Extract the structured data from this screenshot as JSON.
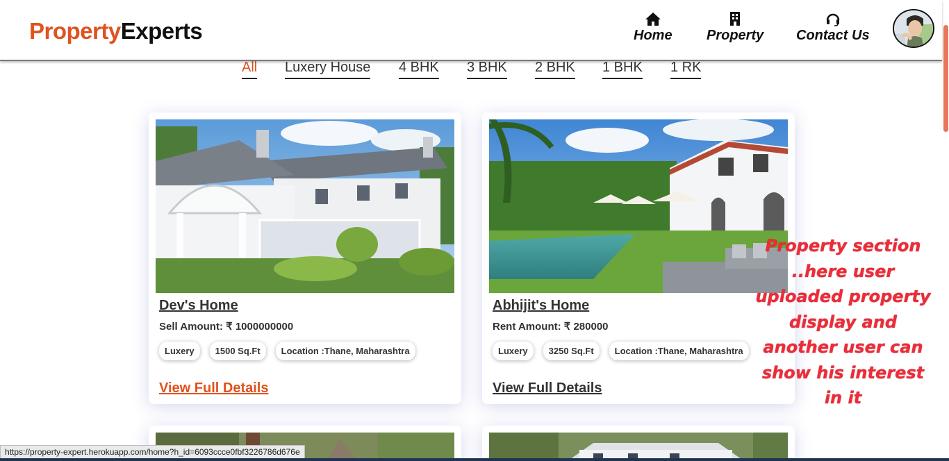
{
  "brand": {
    "part1": "Property",
    "part2": "Experts"
  },
  "nav": {
    "home": "Home",
    "property": "Property",
    "contact": "Contact Us"
  },
  "filters": [
    "All",
    "Luxery House",
    "4 BHK",
    "3 BHK",
    "2 BHK",
    "1 BHK",
    "1 RK"
  ],
  "cards": [
    {
      "title": "Dev's Home",
      "amount": "Sell Amount: ₹ 1000000000",
      "tags": [
        "Luxery",
        "1500 Sq.Ft",
        "Location :Thane, Maharashtra"
      ],
      "view": "View Full Details"
    },
    {
      "title": "Abhijit's Home",
      "amount": "Rent Amount: ₹ 280000",
      "tags": [
        "Luxery",
        "3250 Sq.Ft",
        "Location :Thane, Maharashtra"
      ],
      "view": "View Full Details"
    }
  ],
  "annotation": "Property section ..here user uploaded property display and another user can show his interest in it",
  "status_url": "https://property-expert.herokuapp.com/home?h_id=6093ccce0fbf3226786d676e",
  "colors": {
    "accent": "#e0521f",
    "annotation": "#ee2b38",
    "scroll_thumb": "#e8775a"
  },
  "icons": {
    "home": "home-icon",
    "property": "building-icon",
    "contact": "headset-icon"
  }
}
